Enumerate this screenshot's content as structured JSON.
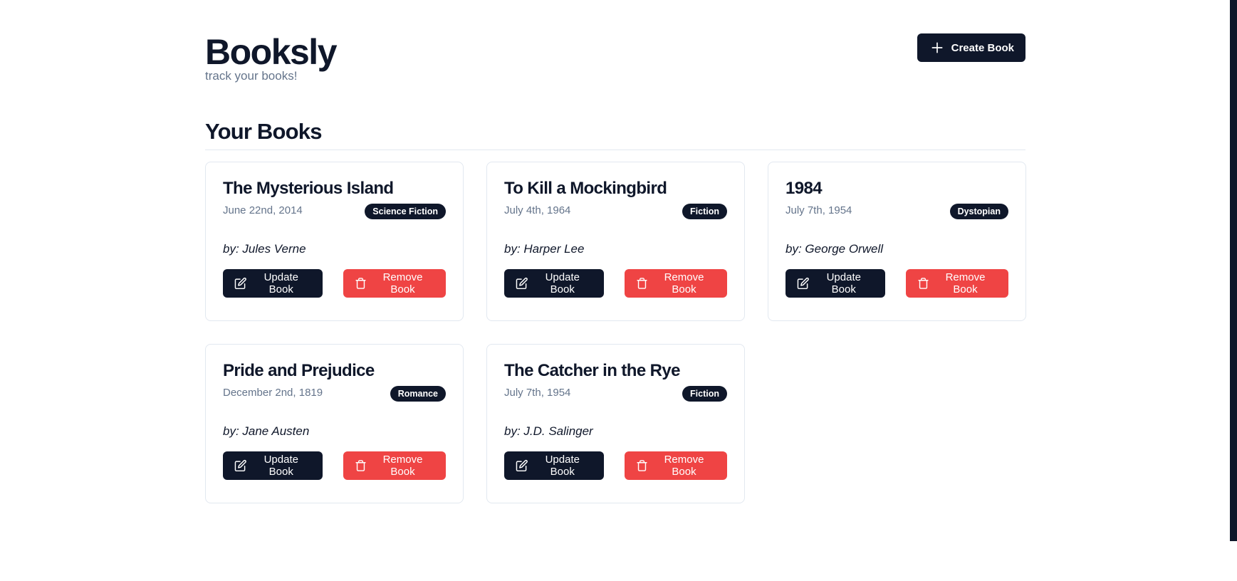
{
  "app": {
    "title": "Booksly",
    "subtitle": "track your books!",
    "create_label": "Create Book"
  },
  "section": {
    "title": "Your Books"
  },
  "colors": {
    "primary": "#0f172a",
    "danger": "#ef4444",
    "muted": "#64748b",
    "border": "#e2e8f0"
  },
  "books": [
    {
      "title": "The Mysterious Island",
      "date": "June 22nd, 2014",
      "genre": "Science Fiction",
      "author": "by: Jules Verne",
      "update_label": "Update Book",
      "remove_label": "Remove Book"
    },
    {
      "title": "To Kill a Mockingbird",
      "date": "July 4th, 1964",
      "genre": "Fiction",
      "author": "by: Harper Lee",
      "update_label": "Update Book",
      "remove_label": "Remove Book"
    },
    {
      "title": "1984",
      "date": "July 7th, 1954",
      "genre": "Dystopian",
      "author": "by: George Orwell",
      "update_label": "Update Book",
      "remove_label": "Remove Book"
    },
    {
      "title": "Pride and Prejudice",
      "date": "December 2nd, 1819",
      "genre": "Romance",
      "author": "by: Jane Austen",
      "update_label": "Update Book",
      "remove_label": "Remove Book"
    },
    {
      "title": "The Catcher in the Rye",
      "date": "July 7th, 1954",
      "genre": "Fiction",
      "author": "by: J.D. Salinger",
      "update_label": "Update Book",
      "remove_label": "Remove Book"
    }
  ],
  "icons": {
    "create": "plus-icon",
    "update": "edit-icon",
    "remove": "trash-icon"
  }
}
